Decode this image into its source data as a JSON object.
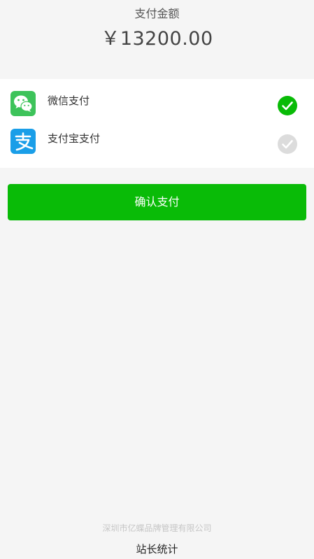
{
  "payment": {
    "amount_label": "支付金额",
    "amount": "￥13200.00"
  },
  "methods": [
    {
      "label": "微信支付",
      "icon": "wechat-icon",
      "selected": true,
      "color": "#3dc35a"
    },
    {
      "label": "支付宝支付",
      "icon": "alipay-icon",
      "selected": false,
      "color": "#1a9ee8"
    }
  ],
  "confirm": {
    "label": "确认支付",
    "color": "#09bb07"
  },
  "footer": {
    "company": "深圳市亿蝶品牌管理有限公司",
    "stats_link": "站长统计"
  },
  "colors": {
    "selected_check": "#09bb07",
    "unselected_check": "#dcdcdc",
    "background": "#f5f5f5"
  }
}
